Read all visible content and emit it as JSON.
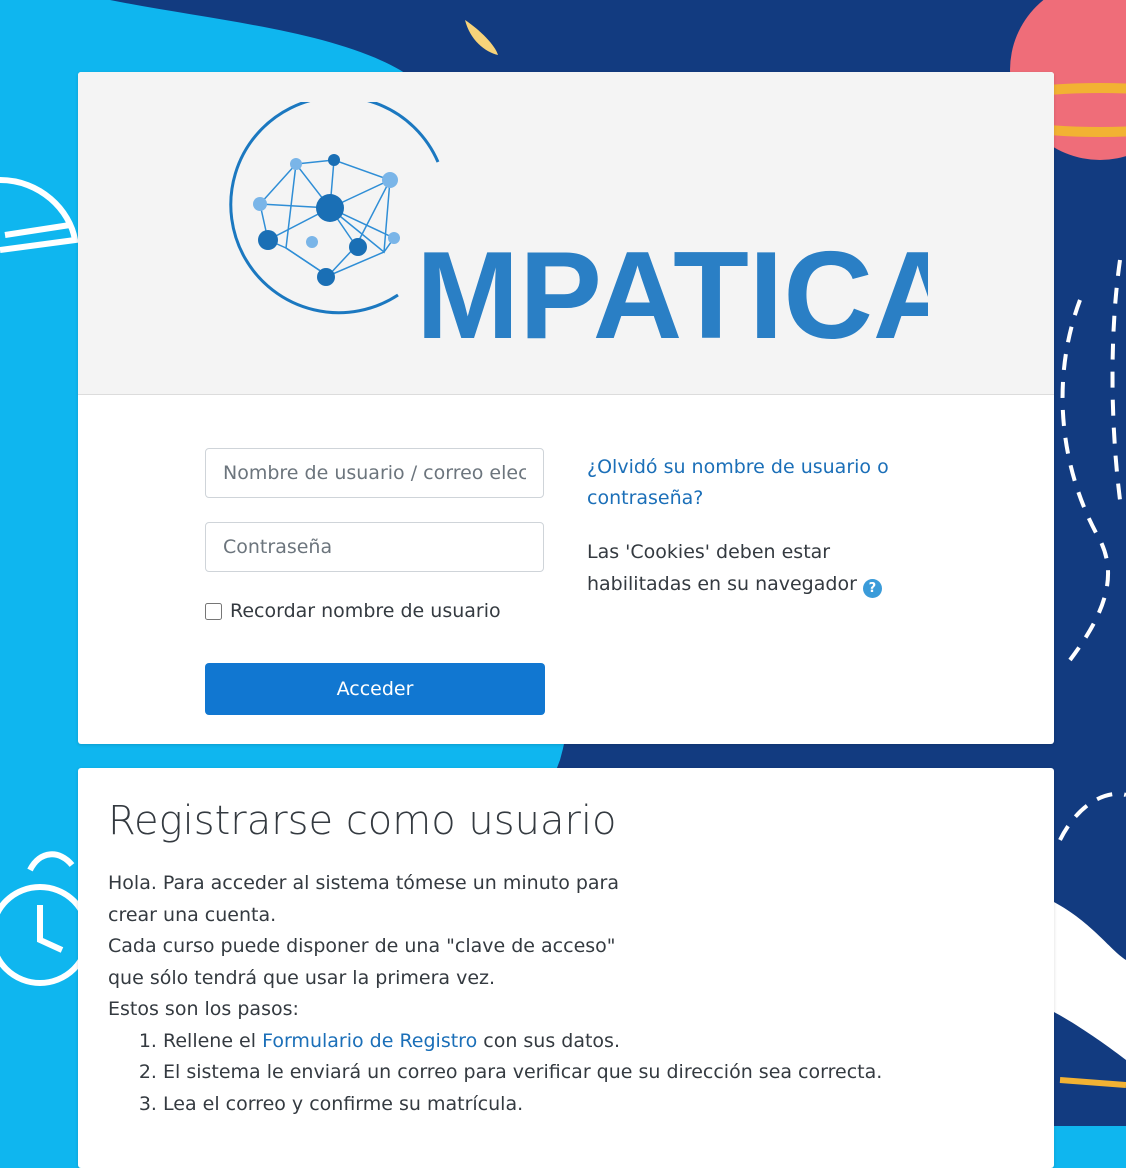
{
  "brand": {
    "name": "MPATICA"
  },
  "login": {
    "username_placeholder": "Nombre de usuario / correo electrónico",
    "password_placeholder": "Contraseña",
    "remember_label": "Recordar nombre de usuario",
    "submit_label": "Acceder",
    "forgot_link": "¿Olvidó su nombre de usuario o contraseña?",
    "cookies_notice": "Las 'Cookies' deben estar habilitadas en su navegador",
    "help_icon": "question-circle-icon"
  },
  "register": {
    "title": "Registrarse como usuario",
    "intro_1": "Hola. Para acceder al sistema tómese un minuto para",
    "intro_2": "crear una cuenta.",
    "intro_3": "Cada curso puede disponer de una \"clave de acceso\"",
    "intro_4": "que sólo tendrá que usar la primera vez.",
    "steps_heading": "Estos son los pasos:",
    "step_1_prefix": "Rellene el",
    "step_1_link": "Formulario de Registro",
    "step_1_suffix": "con sus datos.",
    "step_2": "El sistema le enviará un correo para verificar que su dirección sea correcta.",
    "step_3": "Lea el correo y confirme su matrícula."
  },
  "colors": {
    "background_light": "#0fb6ef",
    "background_dark": "#123b80",
    "accent": "#1177d1",
    "link": "#1b6fb8"
  }
}
